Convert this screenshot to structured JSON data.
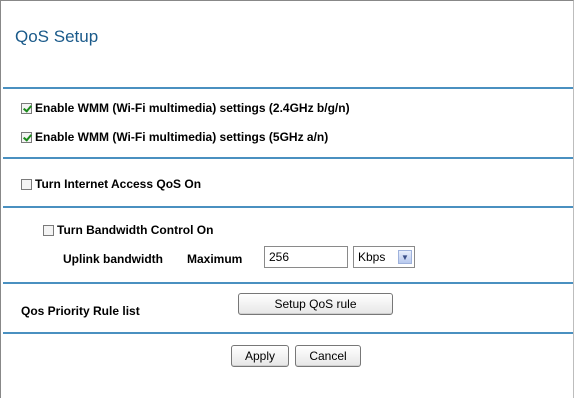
{
  "title": "QoS Setup",
  "wmm_24": {
    "label": "Enable WMM (Wi-Fi multimedia) settings (2.4GHz b/g/n)",
    "checked": true
  },
  "wmm_5": {
    "label": "Enable WMM (Wi-Fi multimedia) settings (5GHz a/n)",
    "checked": true
  },
  "internet_qos": {
    "label": "Turn Internet Access QoS On",
    "checked": false
  },
  "bandwidth_control": {
    "label": "Turn Bandwidth Control On",
    "checked": false
  },
  "uplink": {
    "label": "Uplink bandwidth",
    "maximum_label": "Maximum",
    "value": "256",
    "unit": "Kbps"
  },
  "priority": {
    "label": "Qos Priority Rule list",
    "button": "Setup QoS rule"
  },
  "actions": {
    "apply": "Apply",
    "cancel": "Cancel"
  },
  "colors": {
    "title": "#1a5a8a",
    "rule": "#4a90c0",
    "check": "#1a8a1a"
  },
  "icons": {
    "checkbox_checked": "checkbox-checked-icon",
    "checkbox_unchecked": "checkbox-unchecked-icon",
    "dropdown_arrow": "chevron-down-icon"
  }
}
